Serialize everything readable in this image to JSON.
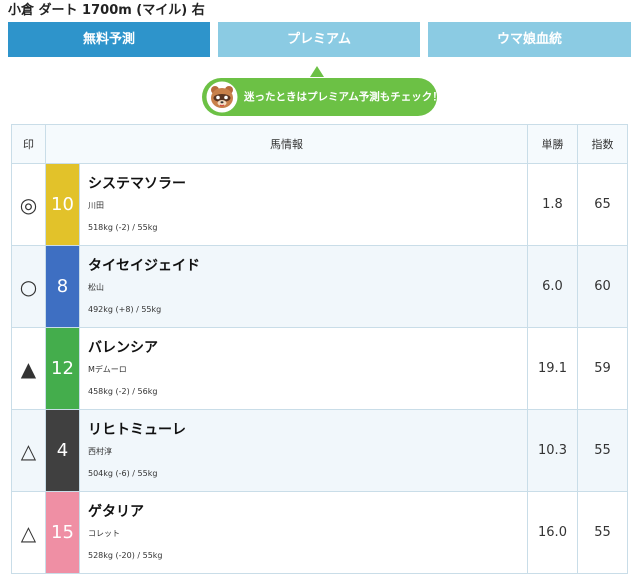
{
  "race": {
    "title": "小倉 ダート 1700m (マイル) 右"
  },
  "tabs": [
    {
      "label": "無料予測",
      "active": true
    },
    {
      "label": "プレミアム",
      "active": false
    },
    {
      "label": "ウマ娘血統",
      "active": false
    }
  ],
  "promo": {
    "text": "迷ったときはプレミアム予測もチェック！",
    "icon": "raccoon-dog-face-icon"
  },
  "table": {
    "headers": {
      "mark": "印",
      "info": "馬情報",
      "odds": "単勝",
      "index": "指数"
    },
    "rows": [
      {
        "mark": "◎",
        "number": "10",
        "number_color": "#e2c22a",
        "name": "システマソラー",
        "jockey": "川田",
        "weight": "518kg (-2) / 55kg",
        "odds": "1.8",
        "index": "65"
      },
      {
        "mark": "○",
        "number": "8",
        "number_color": "#3e6fc2",
        "name": "タイセイジェイド",
        "jockey": "松山",
        "weight": "492kg (+8) / 55kg",
        "odds": "6.0",
        "index": "60"
      },
      {
        "mark": "▲",
        "number": "12",
        "number_color": "#44ad4c",
        "name": "バレンシア",
        "jockey": "Mデムーロ",
        "weight": "458kg (-2) / 56kg",
        "odds": "19.1",
        "index": "59"
      },
      {
        "mark": "△",
        "number": "4",
        "number_color": "#404040",
        "name": "リヒトミューレ",
        "jockey": "西村淳",
        "weight": "504kg (-6) / 55kg",
        "odds": "10.3",
        "index": "55"
      },
      {
        "mark": "△",
        "number": "15",
        "number_color": "#ef8fa4",
        "name": "ゲタリア",
        "jockey": "コレット",
        "weight": "528kg (-20) / 55kg",
        "odds": "16.0",
        "index": "55"
      }
    ]
  },
  "colors": {
    "tab_active": "#2e94cb",
    "tab_inactive": "#8bcbe3",
    "promo": "#6cc145",
    "row_alt": "#f1f7fb"
  }
}
